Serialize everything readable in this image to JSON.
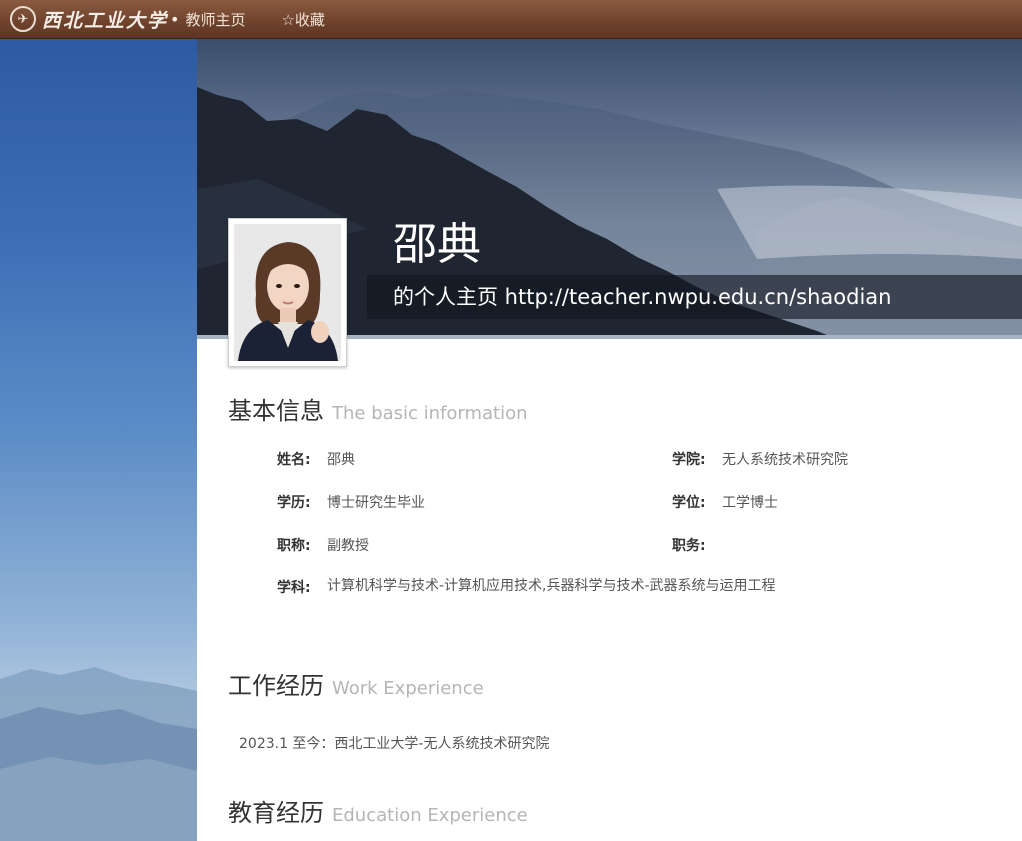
{
  "topbar": {
    "logo_text": "西北工业大学",
    "logo_dot": "•",
    "nav_home": "教师主页",
    "nav_favorite": "☆收藏"
  },
  "profile": {
    "name": "邵典",
    "homepage_line": "的个人主页 http://teacher.nwpu.edu.cn/shaodian"
  },
  "basic_info": {
    "title_cn": "基本信息",
    "title_en": "The basic information",
    "fields": {
      "name": {
        "label": "姓名:",
        "value": "邵典"
      },
      "college": {
        "label": "学院:",
        "value": "无人系统技术研究院"
      },
      "education": {
        "label": "学历:",
        "value": "博士研究生毕业"
      },
      "degree": {
        "label": "学位:",
        "value": "工学博士"
      },
      "title": {
        "label": "职称:",
        "value": "副教授"
      },
      "position": {
        "label": "职务:",
        "value": ""
      },
      "discipline": {
        "label": "学科:",
        "value": "计算机科学与技术-计算机应用技术,兵器科学与技术-武器系统与运用工程"
      }
    }
  },
  "work_experience": {
    "title_cn": "工作经历",
    "title_en": "Work Experience",
    "items": [
      "2023.1 至今：西北工业大学-无人系统技术研究院"
    ]
  },
  "education_experience": {
    "title_cn": "教育经历",
    "title_en": "Education Experience"
  }
}
